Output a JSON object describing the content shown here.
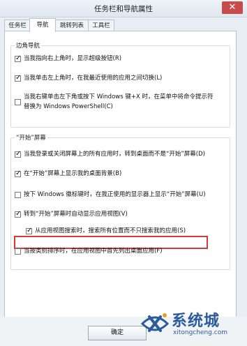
{
  "window": {
    "title": "任务栏和导航属性",
    "close_glyph": "✕"
  },
  "tabs": [
    {
      "label": "任务栏",
      "active": false
    },
    {
      "label": "导航",
      "active": true
    },
    {
      "label": "跳转列表",
      "active": false
    },
    {
      "label": "工具栏",
      "active": false
    }
  ],
  "corner_nav": {
    "title": "边角导航",
    "options": [
      {
        "label": "当我指向右上角时，显示超级按钮(R)",
        "checked": true
      },
      {
        "label": "当我单击左上角时，在我最近使用的应用之间切换(L)",
        "checked": true
      },
      {
        "label_line1": "当我右键单击左下角或按下 Windows 键+X 时，在菜单中将命令提示符",
        "label_line2": "替换为 Windows PowerShell(C)",
        "checked": false
      }
    ]
  },
  "start_screen": {
    "title": "“开始”屏幕",
    "options": [
      {
        "label": "当我登录或关闭屏幕上的所有应用时，转到桌面而不是“开始”屏幕(D)",
        "checked": true
      },
      {
        "label": "在“开始”屏幕上显示我的桌面背景(B)",
        "checked": true
      },
      {
        "label": "按下 Windows 徽标键时，在我正使用的显示器上显示“开始”屏幕(U)",
        "checked": false
      },
      {
        "label": "转到“开始”屏幕时自动显示应用视图(V)",
        "checked": true
      },
      {
        "label": "从应用视图搜索时，搜索所有位置而不只搜索我的应用(S)",
        "checked": true
      },
      {
        "label": "当按类别排序时，在应用视图中首先列出桌面应用(F)",
        "checked": false
      }
    ]
  },
  "buttons": {
    "ok": "确定"
  },
  "watermark": {
    "brand": "系统城",
    "url": "xitongcheng.com"
  },
  "colors": {
    "highlight_border": "#d33b3b",
    "brand_blue": "#2b5b9a"
  }
}
